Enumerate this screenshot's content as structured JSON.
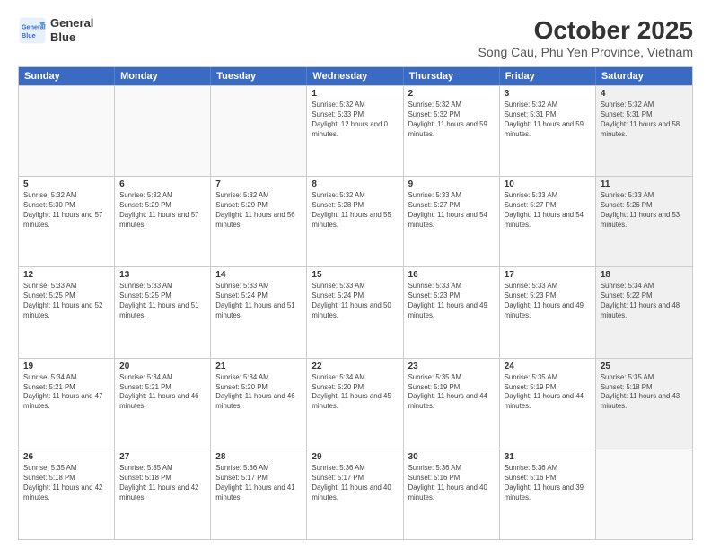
{
  "header": {
    "logo_line1": "General",
    "logo_line2": "Blue",
    "month": "October 2025",
    "location": "Song Cau, Phu Yen Province, Vietnam"
  },
  "days_of_week": [
    "Sunday",
    "Monday",
    "Tuesday",
    "Wednesday",
    "Thursday",
    "Friday",
    "Saturday"
  ],
  "weeks": [
    [
      {
        "day": "",
        "sunrise": "",
        "sunset": "",
        "daylight": "",
        "empty": true
      },
      {
        "day": "",
        "sunrise": "",
        "sunset": "",
        "daylight": "",
        "empty": true
      },
      {
        "day": "",
        "sunrise": "",
        "sunset": "",
        "daylight": "",
        "empty": true
      },
      {
        "day": "1",
        "sunrise": "Sunrise: 5:32 AM",
        "sunset": "Sunset: 5:33 PM",
        "daylight": "Daylight: 12 hours and 0 minutes.",
        "empty": false
      },
      {
        "day": "2",
        "sunrise": "Sunrise: 5:32 AM",
        "sunset": "Sunset: 5:32 PM",
        "daylight": "Daylight: 11 hours and 59 minutes.",
        "empty": false
      },
      {
        "day": "3",
        "sunrise": "Sunrise: 5:32 AM",
        "sunset": "Sunset: 5:31 PM",
        "daylight": "Daylight: 11 hours and 59 minutes.",
        "empty": false
      },
      {
        "day": "4",
        "sunrise": "Sunrise: 5:32 AM",
        "sunset": "Sunset: 5:31 PM",
        "daylight": "Daylight: 11 hours and 58 minutes.",
        "empty": false,
        "shaded": true
      }
    ],
    [
      {
        "day": "5",
        "sunrise": "Sunrise: 5:32 AM",
        "sunset": "Sunset: 5:30 PM",
        "daylight": "Daylight: 11 hours and 57 minutes.",
        "empty": false
      },
      {
        "day": "6",
        "sunrise": "Sunrise: 5:32 AM",
        "sunset": "Sunset: 5:29 PM",
        "daylight": "Daylight: 11 hours and 57 minutes.",
        "empty": false
      },
      {
        "day": "7",
        "sunrise": "Sunrise: 5:32 AM",
        "sunset": "Sunset: 5:29 PM",
        "daylight": "Daylight: 11 hours and 56 minutes.",
        "empty": false
      },
      {
        "day": "8",
        "sunrise": "Sunrise: 5:32 AM",
        "sunset": "Sunset: 5:28 PM",
        "daylight": "Daylight: 11 hours and 55 minutes.",
        "empty": false
      },
      {
        "day": "9",
        "sunrise": "Sunrise: 5:33 AM",
        "sunset": "Sunset: 5:27 PM",
        "daylight": "Daylight: 11 hours and 54 minutes.",
        "empty": false
      },
      {
        "day": "10",
        "sunrise": "Sunrise: 5:33 AM",
        "sunset": "Sunset: 5:27 PM",
        "daylight": "Daylight: 11 hours and 54 minutes.",
        "empty": false
      },
      {
        "day": "11",
        "sunrise": "Sunrise: 5:33 AM",
        "sunset": "Sunset: 5:26 PM",
        "daylight": "Daylight: 11 hours and 53 minutes.",
        "empty": false,
        "shaded": true
      }
    ],
    [
      {
        "day": "12",
        "sunrise": "Sunrise: 5:33 AM",
        "sunset": "Sunset: 5:25 PM",
        "daylight": "Daylight: 11 hours and 52 minutes.",
        "empty": false
      },
      {
        "day": "13",
        "sunrise": "Sunrise: 5:33 AM",
        "sunset": "Sunset: 5:25 PM",
        "daylight": "Daylight: 11 hours and 51 minutes.",
        "empty": false
      },
      {
        "day": "14",
        "sunrise": "Sunrise: 5:33 AM",
        "sunset": "Sunset: 5:24 PM",
        "daylight": "Daylight: 11 hours and 51 minutes.",
        "empty": false
      },
      {
        "day": "15",
        "sunrise": "Sunrise: 5:33 AM",
        "sunset": "Sunset: 5:24 PM",
        "daylight": "Daylight: 11 hours and 50 minutes.",
        "empty": false
      },
      {
        "day": "16",
        "sunrise": "Sunrise: 5:33 AM",
        "sunset": "Sunset: 5:23 PM",
        "daylight": "Daylight: 11 hours and 49 minutes.",
        "empty": false
      },
      {
        "day": "17",
        "sunrise": "Sunrise: 5:33 AM",
        "sunset": "Sunset: 5:23 PM",
        "daylight": "Daylight: 11 hours and 49 minutes.",
        "empty": false
      },
      {
        "day": "18",
        "sunrise": "Sunrise: 5:34 AM",
        "sunset": "Sunset: 5:22 PM",
        "daylight": "Daylight: 11 hours and 48 minutes.",
        "empty": false,
        "shaded": true
      }
    ],
    [
      {
        "day": "19",
        "sunrise": "Sunrise: 5:34 AM",
        "sunset": "Sunset: 5:21 PM",
        "daylight": "Daylight: 11 hours and 47 minutes.",
        "empty": false
      },
      {
        "day": "20",
        "sunrise": "Sunrise: 5:34 AM",
        "sunset": "Sunset: 5:21 PM",
        "daylight": "Daylight: 11 hours and 46 minutes.",
        "empty": false
      },
      {
        "day": "21",
        "sunrise": "Sunrise: 5:34 AM",
        "sunset": "Sunset: 5:20 PM",
        "daylight": "Daylight: 11 hours and 46 minutes.",
        "empty": false
      },
      {
        "day": "22",
        "sunrise": "Sunrise: 5:34 AM",
        "sunset": "Sunset: 5:20 PM",
        "daylight": "Daylight: 11 hours and 45 minutes.",
        "empty": false
      },
      {
        "day": "23",
        "sunrise": "Sunrise: 5:35 AM",
        "sunset": "Sunset: 5:19 PM",
        "daylight": "Daylight: 11 hours and 44 minutes.",
        "empty": false
      },
      {
        "day": "24",
        "sunrise": "Sunrise: 5:35 AM",
        "sunset": "Sunset: 5:19 PM",
        "daylight": "Daylight: 11 hours and 44 minutes.",
        "empty": false
      },
      {
        "day": "25",
        "sunrise": "Sunrise: 5:35 AM",
        "sunset": "Sunset: 5:18 PM",
        "daylight": "Daylight: 11 hours and 43 minutes.",
        "empty": false,
        "shaded": true
      }
    ],
    [
      {
        "day": "26",
        "sunrise": "Sunrise: 5:35 AM",
        "sunset": "Sunset: 5:18 PM",
        "daylight": "Daylight: 11 hours and 42 minutes.",
        "empty": false
      },
      {
        "day": "27",
        "sunrise": "Sunrise: 5:35 AM",
        "sunset": "Sunset: 5:18 PM",
        "daylight": "Daylight: 11 hours and 42 minutes.",
        "empty": false
      },
      {
        "day": "28",
        "sunrise": "Sunrise: 5:36 AM",
        "sunset": "Sunset: 5:17 PM",
        "daylight": "Daylight: 11 hours and 41 minutes.",
        "empty": false
      },
      {
        "day": "29",
        "sunrise": "Sunrise: 5:36 AM",
        "sunset": "Sunset: 5:17 PM",
        "daylight": "Daylight: 11 hours and 40 minutes.",
        "empty": false
      },
      {
        "day": "30",
        "sunrise": "Sunrise: 5:36 AM",
        "sunset": "Sunset: 5:16 PM",
        "daylight": "Daylight: 11 hours and 40 minutes.",
        "empty": false
      },
      {
        "day": "31",
        "sunrise": "Sunrise: 5:36 AM",
        "sunset": "Sunset: 5:16 PM",
        "daylight": "Daylight: 11 hours and 39 minutes.",
        "empty": false
      },
      {
        "day": "",
        "sunrise": "",
        "sunset": "",
        "daylight": "",
        "empty": true,
        "shaded": true
      }
    ]
  ]
}
